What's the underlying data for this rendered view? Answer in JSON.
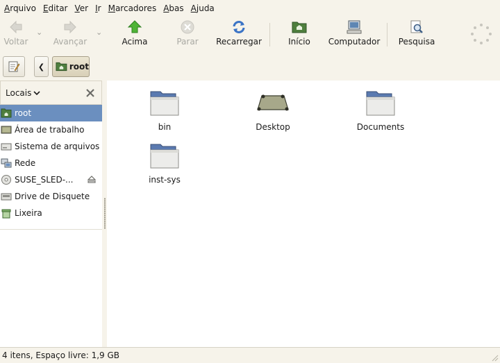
{
  "menubar": {
    "items": [
      {
        "accel": "A",
        "rest": "rquivo"
      },
      {
        "accel": "E",
        "rest": "ditar"
      },
      {
        "accel": "V",
        "rest": "er"
      },
      {
        "accel": "I",
        "rest": "r"
      },
      {
        "accel": "M",
        "rest": "arcadores"
      },
      {
        "accel": "A",
        "rest": "bas"
      },
      {
        "accel": "A",
        "rest": "juda"
      }
    ]
  },
  "toolbar": {
    "back": "Voltar",
    "forward": "Avançar",
    "up": "Acima",
    "stop": "Parar",
    "reload": "Recarregar",
    "home": "Início",
    "computer": "Computador",
    "search": "Pesquisa"
  },
  "location": {
    "current": "root"
  },
  "sidebar": {
    "selector": "Locais",
    "items": [
      {
        "label": "root",
        "icon": "home-folder-icon",
        "selected": true
      },
      {
        "label": "Área de trabalho",
        "icon": "desktop-icon",
        "selected": false
      },
      {
        "label": "Sistema de arquivos",
        "icon": "drive-icon",
        "selected": false
      },
      {
        "label": "Rede",
        "icon": "network-icon",
        "selected": false
      },
      {
        "label": "SUSE_SLED-...",
        "icon": "cdrom-icon",
        "selected": false,
        "eject": true
      },
      {
        "label": "Drive de Disquete",
        "icon": "floppy-icon",
        "selected": false
      },
      {
        "label": "Lixeira",
        "icon": "trash-icon",
        "selected": false
      }
    ]
  },
  "files": [
    {
      "name": "bin",
      "icon": "folder-icon"
    },
    {
      "name": "Desktop",
      "icon": "desktop-folder-icon"
    },
    {
      "name": "Documents",
      "icon": "folder-icon"
    },
    {
      "name": "inst-sys",
      "icon": "folder-icon"
    }
  ],
  "status": {
    "text": "4 itens, Espaço livre: 1,9 GB"
  },
  "colors": {
    "selection": "#6b8fbf",
    "window_bg": "#f6f3ea",
    "accent_green": "#3a9a2a"
  }
}
